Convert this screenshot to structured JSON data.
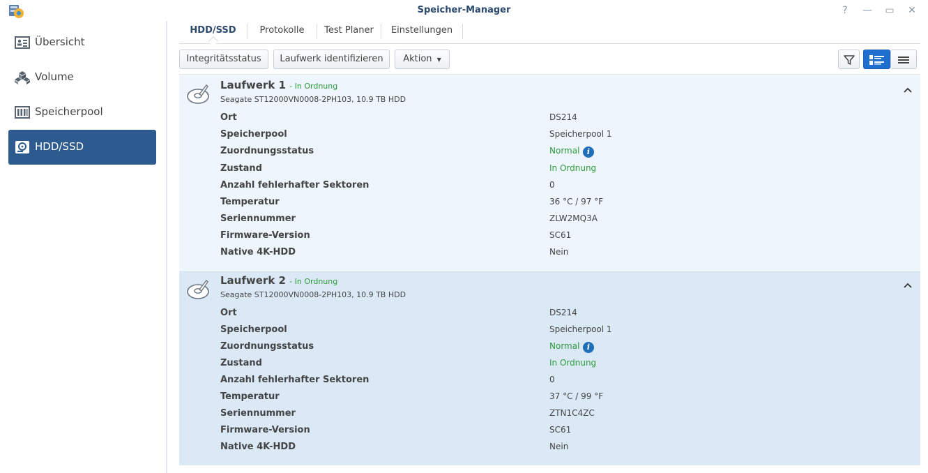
{
  "window": {
    "title": "Speicher-Manager",
    "help": "?",
    "minimize": "—",
    "maximize": "▭",
    "close": "✕"
  },
  "sidebar": {
    "items": [
      {
        "label": "Übersicht",
        "icon": "overview-icon"
      },
      {
        "label": "Volume",
        "icon": "cubes-icon"
      },
      {
        "label": "Speicherpool",
        "icon": "storage-pool-icon"
      },
      {
        "label": "HDD/SSD",
        "icon": "hdd-icon",
        "active": true
      }
    ]
  },
  "tabs": [
    {
      "label": "HDD/SSD",
      "active": true
    },
    {
      "label": "Protokolle"
    },
    {
      "label": "Test Planer"
    },
    {
      "label": "Einstellungen"
    }
  ],
  "toolbar": {
    "health": "Integritätsstatus",
    "identify": "Laufwerk identifizieren",
    "action": "Aktion",
    "filter_icon": "filter-icon",
    "detail_view_icon": "list-detail-icon",
    "list_view_icon": "list-icon"
  },
  "colors": {
    "accent": "#2d5a8f",
    "ok": "#2e9a3a",
    "panel1": "#eef5fc",
    "panel2": "#dbe9f7"
  },
  "drives": [
    {
      "name": "Laufwerk 1",
      "status": "- In Ordnung",
      "model": "Seagate ST12000VN0008-2PH103, 10.9 TB HDD",
      "rows": [
        {
          "key": "Ort",
          "value": "DS214"
        },
        {
          "key": "Speicherpool",
          "value": "Speicherpool 1"
        },
        {
          "key": "Zuordnungsstatus",
          "value": "Normal"
        },
        {
          "key": "Zustand",
          "value": "In Ordnung"
        },
        {
          "key": "Anzahl fehlerhafter Sektoren",
          "value": "0"
        },
        {
          "key": "Temperatur",
          "value": "36 °C / 97 °F"
        },
        {
          "key": "Seriennummer",
          "value": "ZLW2MQ3A"
        },
        {
          "key": "Firmware-Version",
          "value": "SC61"
        },
        {
          "key": "Native 4K-HDD",
          "value": "Nein"
        }
      ]
    },
    {
      "name": "Laufwerk 2",
      "status": "- In Ordnung",
      "model": "Seagate ST12000VN0008-2PH103, 10.9 TB HDD",
      "rows": [
        {
          "key": "Ort",
          "value": "DS214"
        },
        {
          "key": "Speicherpool",
          "value": "Speicherpool 1"
        },
        {
          "key": "Zuordnungsstatus",
          "value": "Normal"
        },
        {
          "key": "Zustand",
          "value": "In Ordnung"
        },
        {
          "key": "Anzahl fehlerhafter Sektoren",
          "value": "0"
        },
        {
          "key": "Temperatur",
          "value": "37 °C / 99 °F"
        },
        {
          "key": "Seriennummer",
          "value": "ZTN1C4ZC"
        },
        {
          "key": "Firmware-Version",
          "value": "SC61"
        },
        {
          "key": "Native 4K-HDD",
          "value": "Nein"
        }
      ]
    }
  ]
}
